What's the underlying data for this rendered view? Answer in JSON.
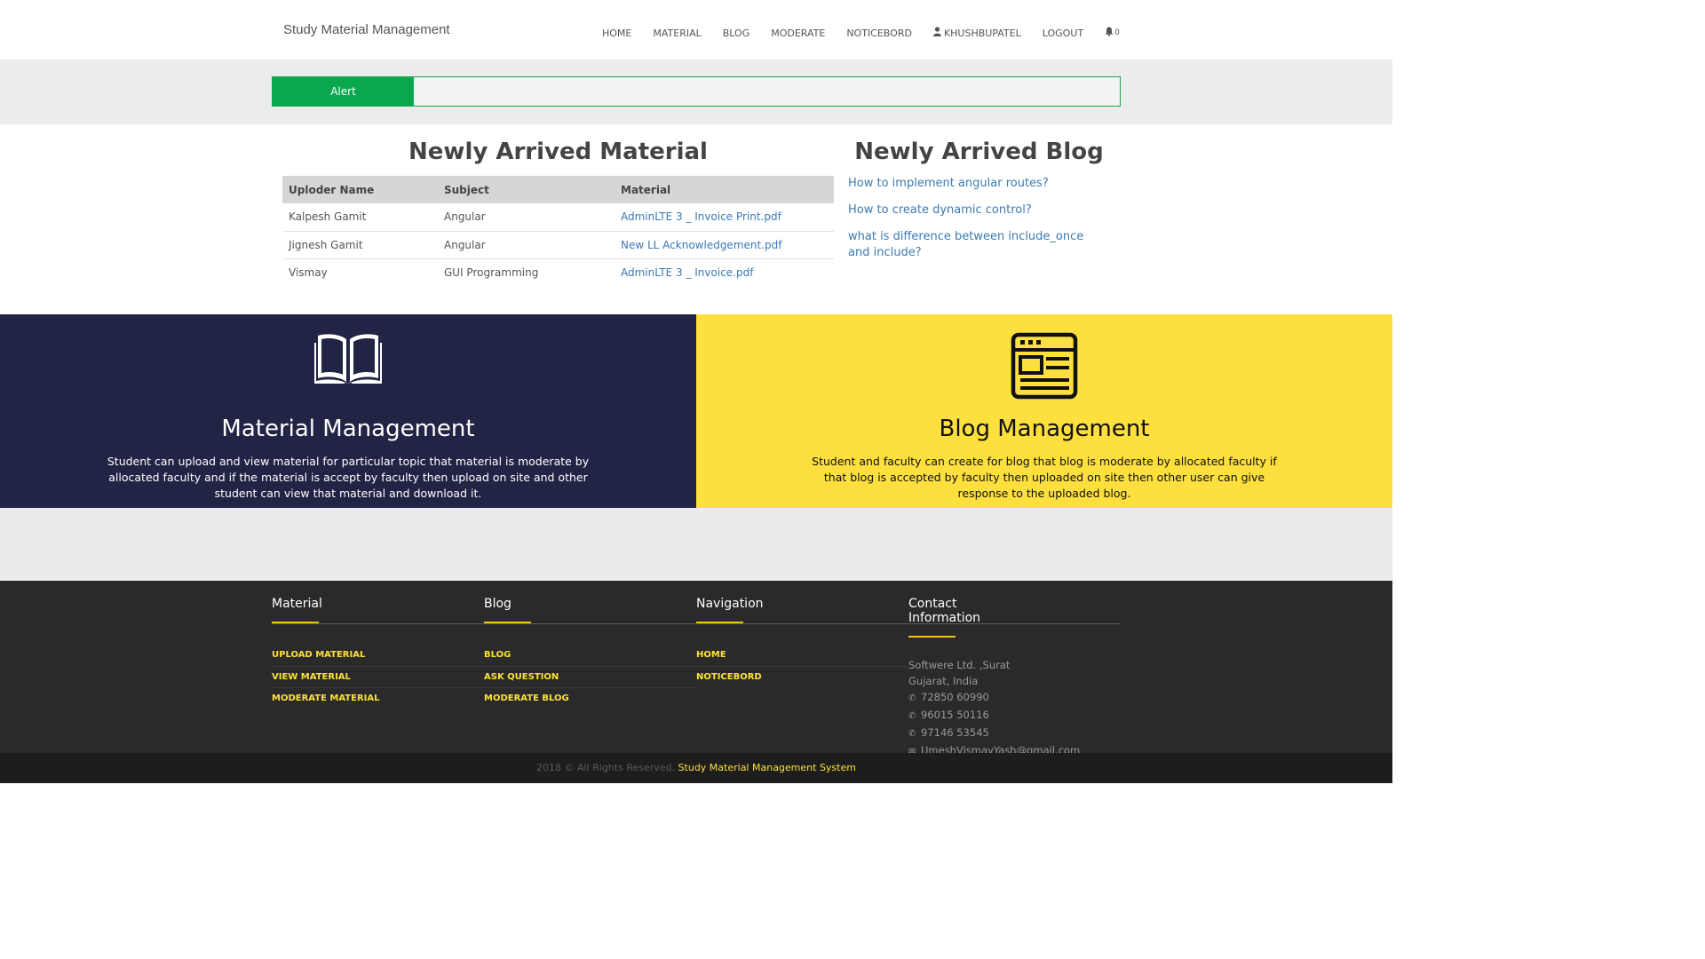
{
  "header": {
    "brand": "Study Material Management",
    "nav": [
      "HOME",
      "MATERIAL",
      "BLOG",
      "MODERATE",
      "NOTICEBORD",
      "KHUSHBUPATEL",
      "LOGOUT"
    ],
    "bell_count": "0"
  },
  "alert": {
    "label": "Alert"
  },
  "material": {
    "title": "Newly Arrived Material",
    "headers": [
      "Uploder Name",
      "Subject",
      "Material"
    ],
    "rows": [
      [
        "Kalpesh Gamit",
        "Angular",
        "AdminLTE 3 _ Invoice Print.pdf"
      ],
      [
        "Jignesh Gamit",
        "Angular",
        "New LL Acknowledgement.pdf"
      ],
      [
        "Vismay",
        "GUI Programming",
        "AdminLTE 3 _ Invoice.pdf"
      ]
    ]
  },
  "blog": {
    "title": "Newly Arrived Blog",
    "links": [
      "How to implement angular routes?",
      "How to create dynamic control?",
      "what is difference between include_once and include?"
    ]
  },
  "panels": {
    "material": {
      "title": "Material Management",
      "text": "Student can upload and view material for particular topic that material is moderate by allocated faculty and if the material is accept by faculty then upload on site and other student can view that material and download it.",
      "icon": "open-book-icon"
    },
    "blog": {
      "title": "Blog Management",
      "text": "Student and faculty can create for blog that blog is moderate by allocated faculty if that blog is accepted by faculty then uploaded on site then other user can give response to the uploaded blog.",
      "icon": "browser-window-icon"
    }
  },
  "footer": {
    "material": {
      "title": "Material",
      "links": [
        "UPLOAD MATERIAL",
        "VIEW MATERIAL",
        "MODERATE MATERIAL"
      ]
    },
    "blog": {
      "title": "Blog",
      "links": [
        "BLOG",
        "ASK QUESTION",
        "MODERATE BLOG"
      ]
    },
    "navigation": {
      "title": "Navigation",
      "links": [
        "HOME",
        "NOTICEBORD"
      ]
    },
    "contact": {
      "title": "Contact Information",
      "address1": "Softwere Ltd. ,Surat",
      "address2": "Gujarat, India",
      "phones": [
        "72850 60990",
        "96015 50116",
        "97146 53545"
      ],
      "email": "UmeshVismayYash@gmail.com"
    },
    "copyright": "2018 © All Rights Reserved.",
    "system_name": "Study Material Management System"
  },
  "colors": {
    "accent_green": "#0aa84e",
    "dark_panel": "#212445",
    "yellow_panel": "#fddf3d",
    "footer_bg": "#2a2a2a",
    "footer_link": "#fce13a",
    "link_blue": "#3a7ab4"
  }
}
